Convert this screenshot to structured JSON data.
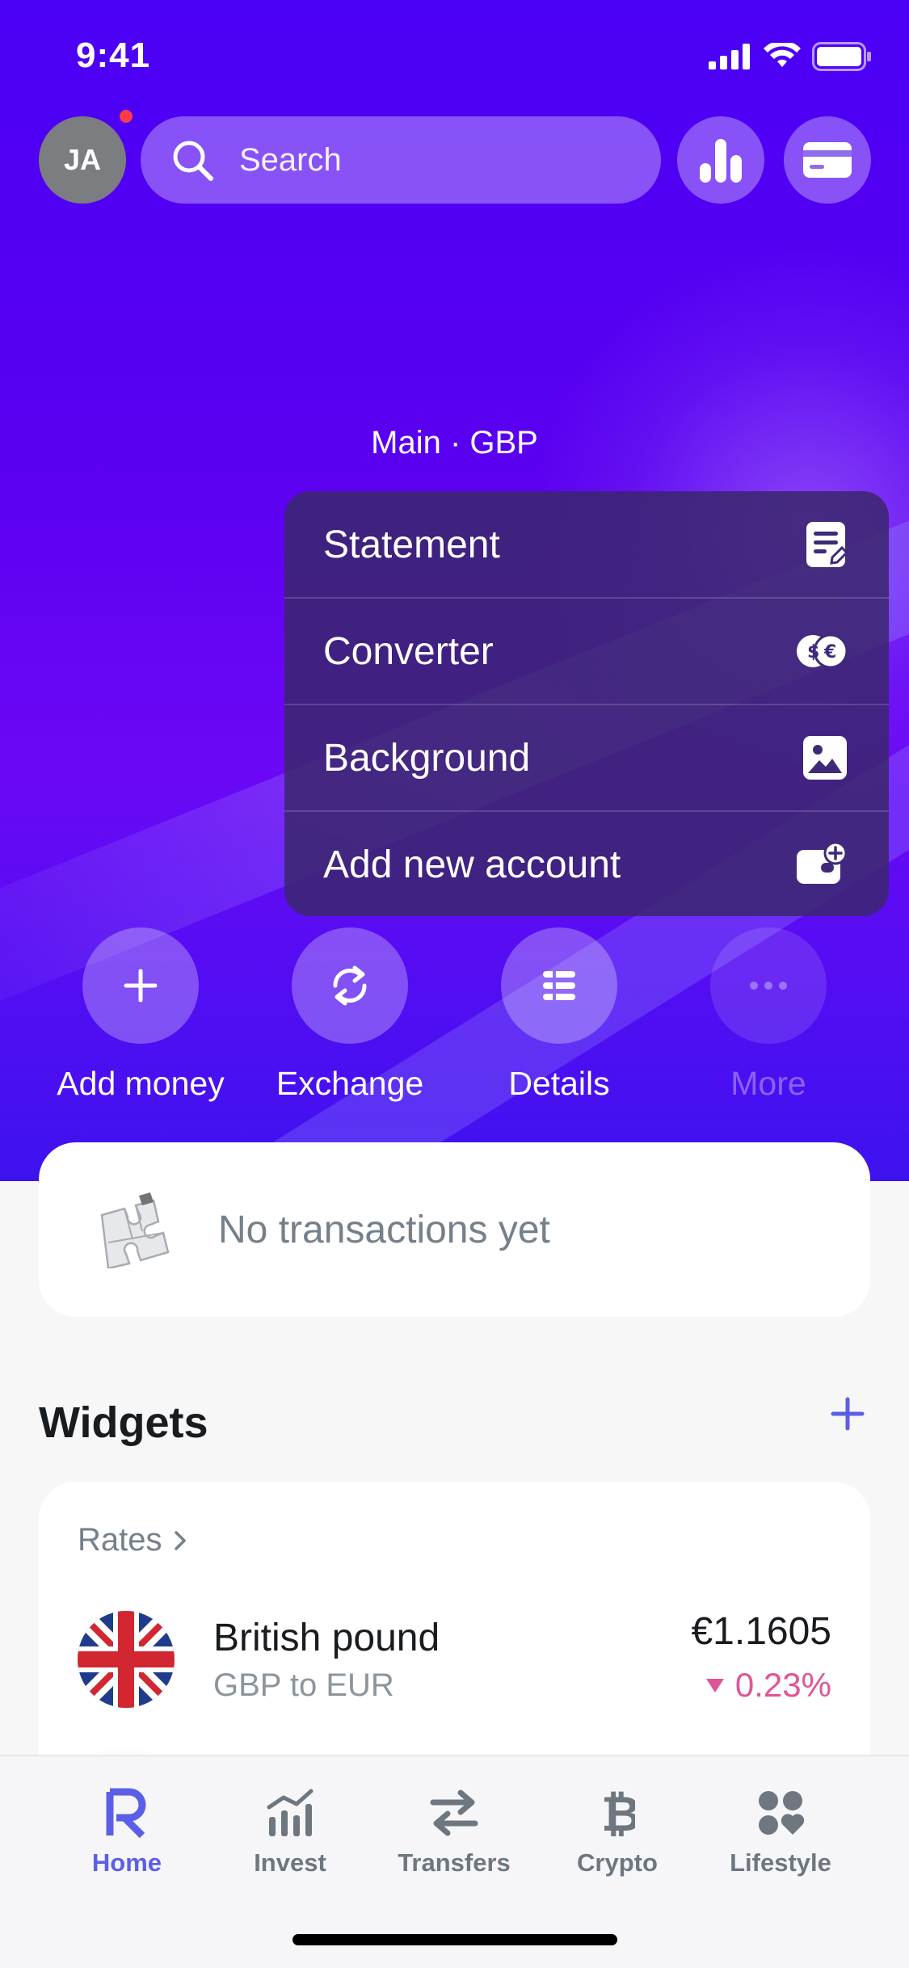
{
  "status_bar": {
    "time": "9:41"
  },
  "header": {
    "avatar_initials": "JA",
    "search_placeholder": "Search"
  },
  "account": {
    "label": "Main · GBP"
  },
  "menu": {
    "items": [
      {
        "label": "Statement",
        "icon": "statement-icon"
      },
      {
        "label": "Converter",
        "icon": "converter-icon"
      },
      {
        "label": "Background",
        "icon": "image-icon"
      },
      {
        "label": "Add new account",
        "icon": "add-account-icon"
      }
    ]
  },
  "actions": [
    {
      "label": "Add money",
      "icon": "plus-icon"
    },
    {
      "label": "Exchange",
      "icon": "exchange-icon"
    },
    {
      "label": "Details",
      "icon": "details-icon"
    },
    {
      "label": "More",
      "icon": "more-icon",
      "disabled": true
    }
  ],
  "transactions": {
    "empty_text": "No transactions yet"
  },
  "widgets": {
    "title": "Widgets",
    "rates": {
      "title": "Rates",
      "currency_name": "British pound",
      "pair": "GBP to EUR",
      "value": "€1.1605",
      "change": "0.23%",
      "change_direction": "down"
    }
  },
  "tabbar": {
    "tabs": [
      {
        "label": "Home",
        "active": true
      },
      {
        "label": "Invest"
      },
      {
        "label": "Transfers"
      },
      {
        "label": "Crypto"
      },
      {
        "label": "Lifestyle"
      }
    ]
  },
  "colors": {
    "accent": "#5b5fe8",
    "hero": "#4a00f5",
    "negative": "#e05597"
  }
}
